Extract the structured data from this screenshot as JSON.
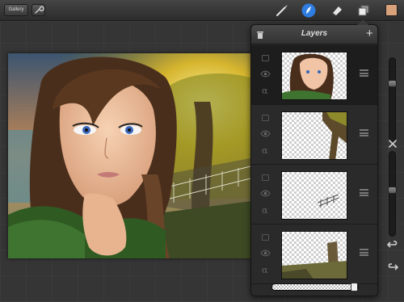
{
  "toolbar": {
    "gallery_label": "Gallery",
    "tools": [
      {
        "name": "brush-icon"
      },
      {
        "name": "smudge-icon",
        "active": true
      },
      {
        "name": "eraser-icon"
      },
      {
        "name": "layers-icon"
      }
    ],
    "accent": "#2f7de0",
    "current_color": "#d9a27a"
  },
  "layers_panel": {
    "title": "Layers",
    "add_label": "+",
    "alpha_symbol": "α",
    "layers": [
      {
        "content": "girl-portrait",
        "visible": true,
        "selected": true
      },
      {
        "content": "tree",
        "visible": true,
        "selected": false
      },
      {
        "content": "bridge-sketch",
        "visible": true,
        "selected": false
      },
      {
        "content": "background",
        "visible": true,
        "selected": false
      }
    ],
    "opacity": 1.0
  },
  "sidebar": {
    "brush_size": 0.72,
    "brush_opacity": 0.55,
    "icons": [
      "swap-icon",
      "undo-icon",
      "redo-icon"
    ]
  }
}
